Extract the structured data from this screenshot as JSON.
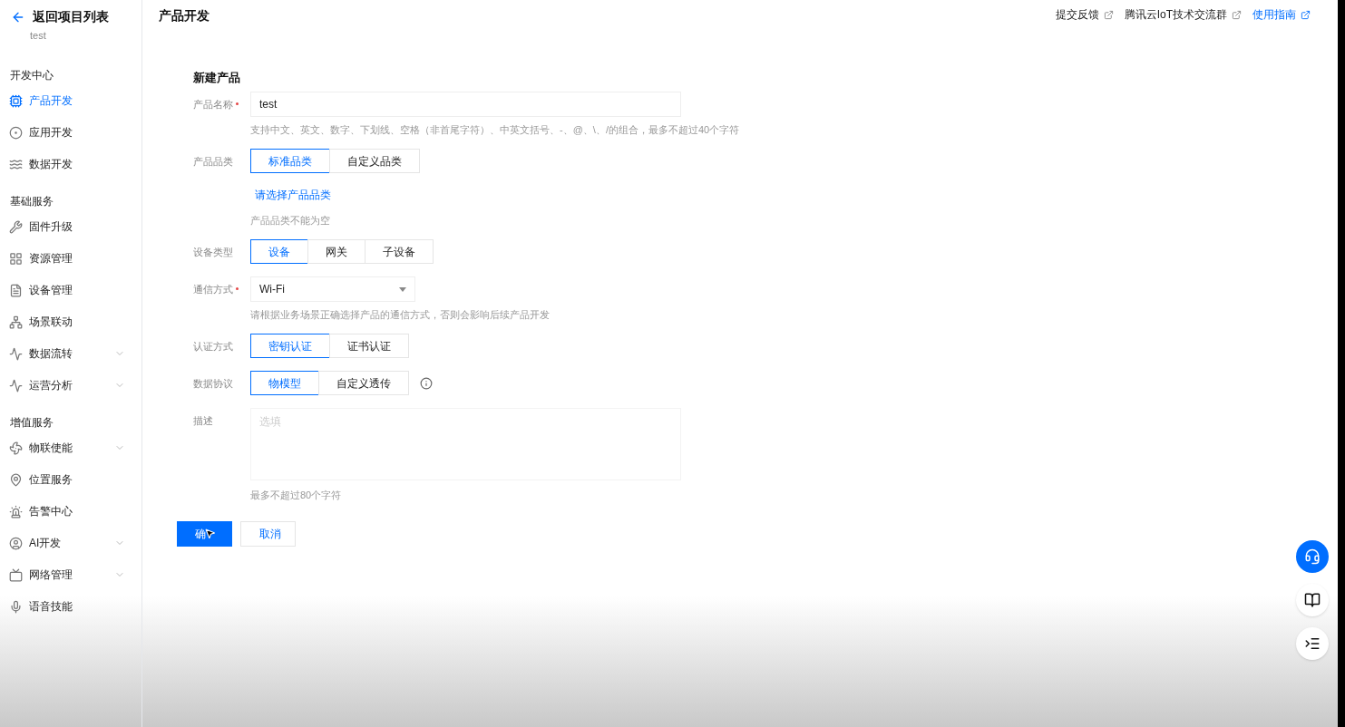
{
  "sidebar": {
    "back_label": "返回项目列表",
    "project": "test",
    "sections": [
      {
        "title": "开发中心",
        "items": [
          {
            "label": "产品开发",
            "selected": true,
            "expandable": false
          },
          {
            "label": "应用开发",
            "selected": false,
            "expandable": false
          },
          {
            "label": "数据开发",
            "selected": false,
            "expandable": false
          }
        ]
      },
      {
        "title": "基础服务",
        "items": [
          {
            "label": "固件升级",
            "selected": false,
            "expandable": false
          },
          {
            "label": "资源管理",
            "selected": false,
            "expandable": false
          },
          {
            "label": "设备管理",
            "selected": false,
            "expandable": false
          },
          {
            "label": "场景联动",
            "selected": false,
            "expandable": false
          },
          {
            "label": "数据流转",
            "selected": false,
            "expandable": true
          },
          {
            "label": "运营分析",
            "selected": false,
            "expandable": true
          }
        ]
      },
      {
        "title": "增值服务",
        "items": [
          {
            "label": "物联使能",
            "selected": false,
            "expandable": true
          },
          {
            "label": "位置服务",
            "selected": false,
            "expandable": false
          },
          {
            "label": "告警中心",
            "selected": false,
            "expandable": false
          },
          {
            "label": "AI开发",
            "selected": false,
            "expandable": true
          },
          {
            "label": "网络管理",
            "selected": false,
            "expandable": true
          },
          {
            "label": "语音技能",
            "selected": false,
            "expandable": false
          }
        ]
      }
    ]
  },
  "header": {
    "title": "产品开发",
    "links": [
      {
        "label": "提交反馈",
        "kind": "plain"
      },
      {
        "label": "腾讯云IoT技术交流群",
        "kind": "plain"
      },
      {
        "label": "使用指南",
        "kind": "primary"
      }
    ]
  },
  "form": {
    "title": "新建产品",
    "fields": [
      {
        "kind": "text",
        "label": "产品名称",
        "required": true,
        "value": "test",
        "hint": "支持中文、英文、数字、下划线、空格（非首尾字符）、中英文括号、-、@、\\、/的组合，最多不超过40个字符"
      },
      {
        "kind": "segmented",
        "label": "产品品类",
        "required": false,
        "options": [
          {
            "label": "标准品类",
            "selected": true
          },
          {
            "label": "自定义品类",
            "selected": false
          }
        ],
        "link": "请选择产品品类",
        "error": "产品品类不能为空"
      },
      {
        "kind": "segmented",
        "label": "设备类型",
        "required": false,
        "options": [
          {
            "label": "设备",
            "selected": true
          },
          {
            "label": "网关",
            "selected": false
          },
          {
            "label": "子设备",
            "selected": false
          }
        ]
      },
      {
        "kind": "select",
        "label": "通信方式",
        "required": true,
        "value": "Wi-Fi",
        "hint": "请根据业务场景正确选择产品的通信方式，否则会影响后续产品开发"
      },
      {
        "kind": "segmented",
        "label": "认证方式",
        "required": false,
        "options": [
          {
            "label": "密钥认证",
            "selected": true
          },
          {
            "label": "证书认证",
            "selected": false
          }
        ]
      },
      {
        "kind": "segmented",
        "label": "数据协议",
        "required": false,
        "info": true,
        "options": [
          {
            "label": "物模型",
            "selected": true
          },
          {
            "label": "自定义透传",
            "selected": false
          }
        ]
      },
      {
        "kind": "textarea",
        "label": "描述",
        "required": false,
        "placeholder": "选填",
        "hint": "最多不超过80个字符"
      }
    ],
    "buttons": [
      {
        "label": "确",
        "kind": "primary"
      },
      {
        "label": "取消",
        "kind": "secondary"
      }
    ]
  }
}
